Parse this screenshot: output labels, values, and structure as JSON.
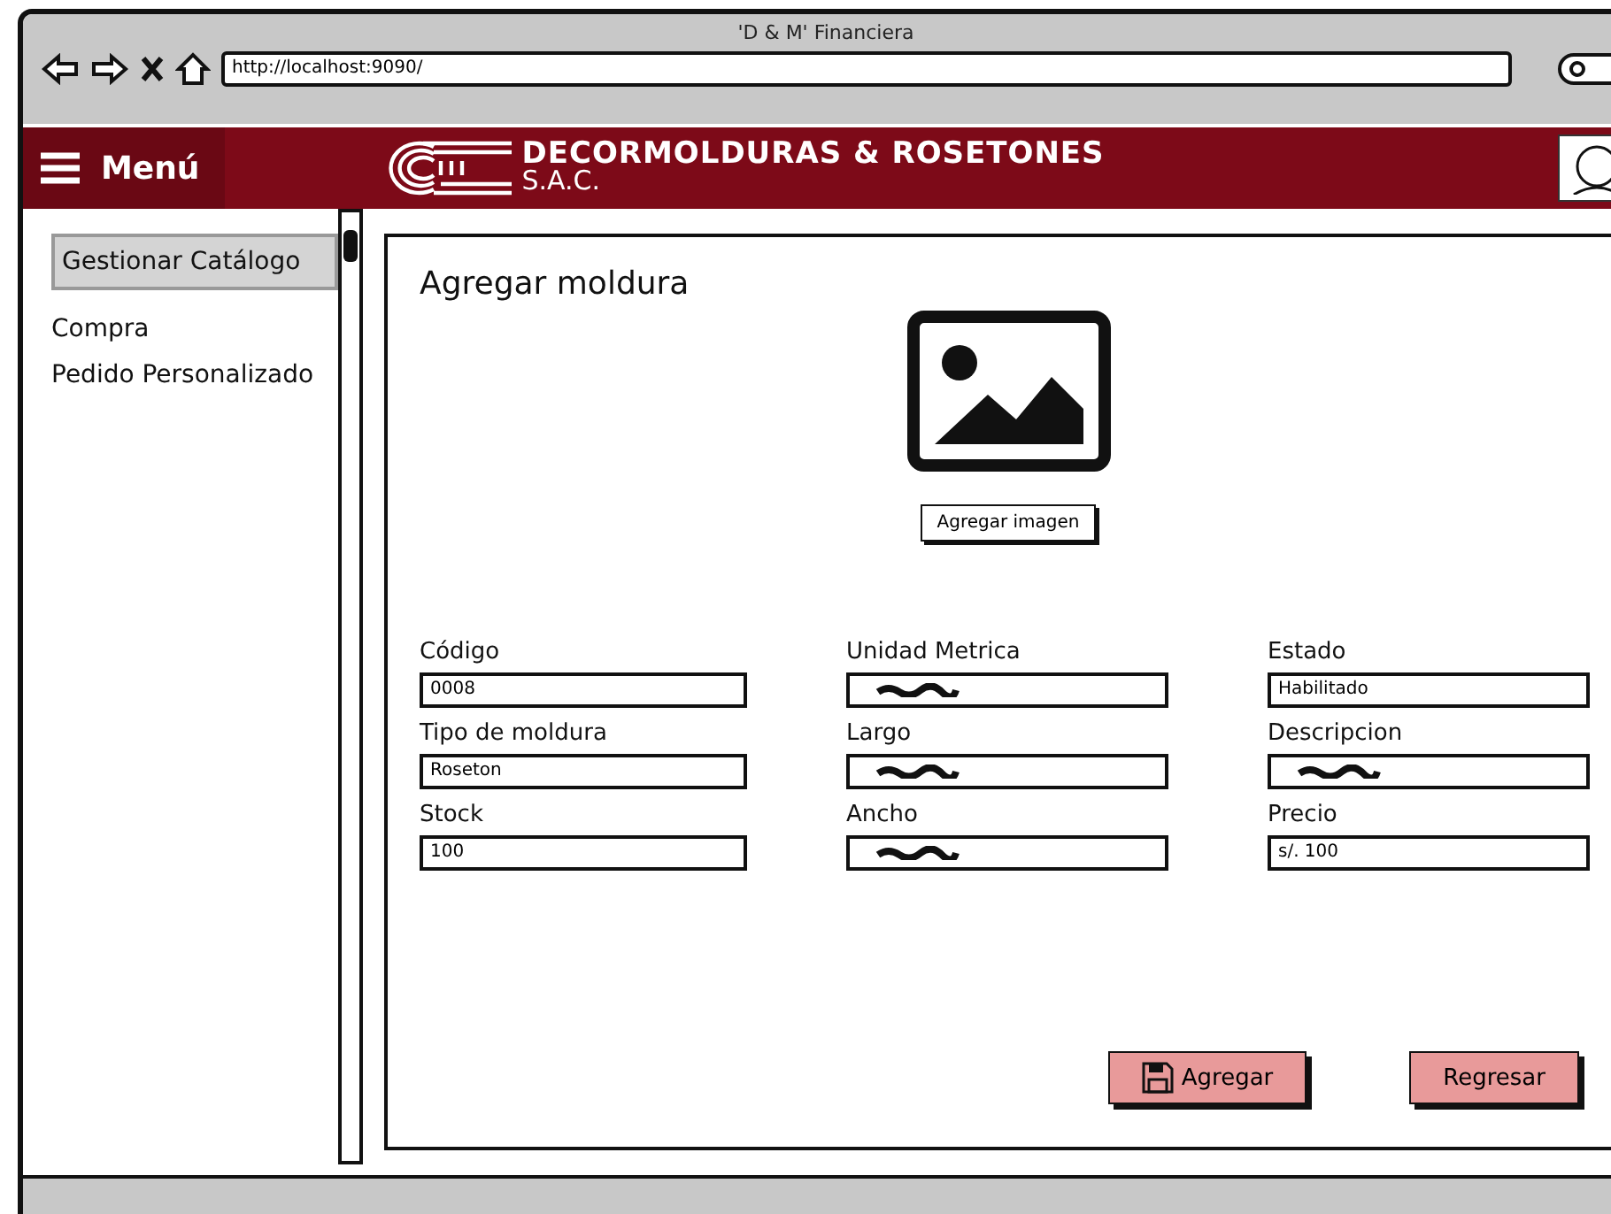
{
  "window": {
    "title": "'D & M' Financiera",
    "url": "http://localhost:9090/"
  },
  "header": {
    "menu_label": "Menú",
    "brand_line_1": "DECORMOLDURAS & ROSETONES",
    "brand_line_2": "S.A.C."
  },
  "sidebar": {
    "items": [
      {
        "label": "Gestionar Catálogo",
        "selected": true
      },
      {
        "label": "Compra",
        "selected": false
      },
      {
        "label": "Pedido Personalizado",
        "selected": false
      }
    ]
  },
  "form": {
    "title": "Agregar moldura",
    "image_button": "Agregar imagen",
    "columns": [
      [
        {
          "label": "Código",
          "kind": "text",
          "value": "0008"
        },
        {
          "label": "Tipo de moldura",
          "kind": "text",
          "value": "Roseton"
        },
        {
          "label": "Stock",
          "kind": "text",
          "value": "100"
        }
      ],
      [
        {
          "label": "Unidad Metrica",
          "kind": "scribble"
        },
        {
          "label": "Largo",
          "kind": "scribble"
        },
        {
          "label": "Ancho",
          "kind": "scribble"
        }
      ],
      [
        {
          "label": "Estado",
          "kind": "text",
          "value": "Habilitado"
        },
        {
          "label": "Descripcion",
          "kind": "scribble"
        },
        {
          "label": "Precio",
          "kind": "text",
          "value": "s/. 100"
        }
      ]
    ],
    "buttons": [
      {
        "label": "Agregar",
        "kind": "save"
      },
      {
        "label": "Regresar",
        "kind": "plain"
      }
    ]
  }
}
